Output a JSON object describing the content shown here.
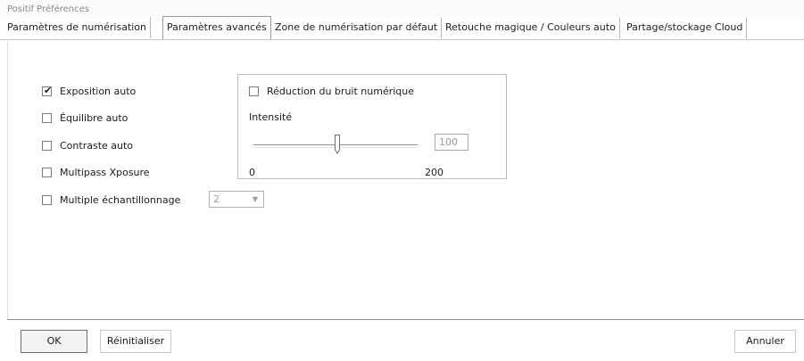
{
  "window": {
    "title": "Positif Préférences"
  },
  "tabs": [
    {
      "label": "Paramètres de numérisation",
      "active": false
    },
    {
      "label": "Paramètres avancés",
      "active": true
    },
    {
      "label": "Zone de numérisation par défaut",
      "active": false
    },
    {
      "label": "Retouche magique / Couleurs auto",
      "active": false
    },
    {
      "label": "Partage/stockage Cloud",
      "active": false
    }
  ],
  "options": {
    "exposition_auto": {
      "label": "Exposition auto",
      "checked": true
    },
    "equilibre_auto": {
      "label": "Équilibre auto",
      "checked": false
    },
    "contraste_auto": {
      "label": "Contraste auto",
      "checked": false
    },
    "multipass": {
      "label": "Multipass Xposure",
      "checked": false
    },
    "multiple_echantillonnage": {
      "label": "Multiple échantillonnage",
      "checked": false,
      "value": "2"
    }
  },
  "noise": {
    "label": "Réduction du bruit numérique",
    "checked": false,
    "intensity_label": "Intensité",
    "intensity_value": "100",
    "slider_min": "0",
    "slider_max": "200"
  },
  "buttons": {
    "ok": "OK",
    "reset": "Réinitialiser",
    "cancel": "Annuler"
  },
  "icons": {
    "check": "check-mark-icon",
    "dropdown": "chevron-down-icon"
  }
}
